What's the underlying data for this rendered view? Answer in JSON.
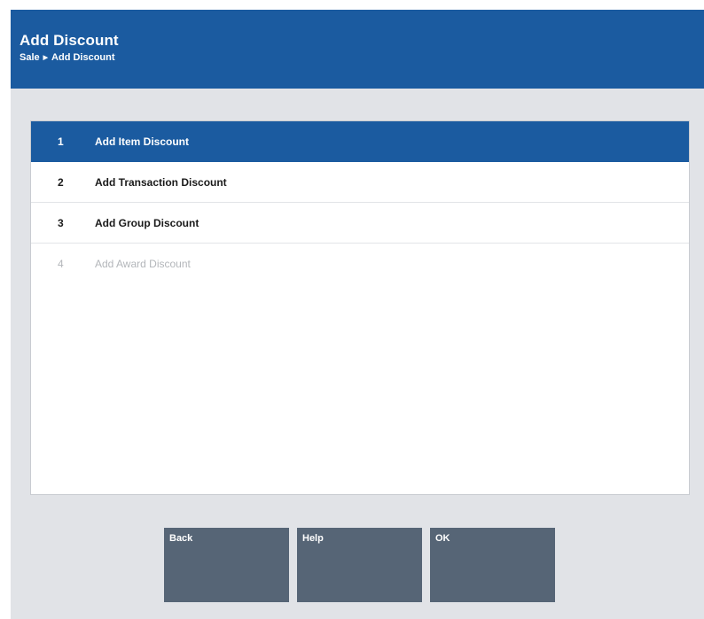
{
  "header": {
    "title": "Add Discount",
    "breadcrumb": [
      "Sale",
      "Add Discount"
    ]
  },
  "menu": {
    "items": [
      {
        "number": "1",
        "label": "Add Item Discount",
        "state": "selected"
      },
      {
        "number": "2",
        "label": "Add Transaction Discount",
        "state": "enabled"
      },
      {
        "number": "3",
        "label": "Add Group Discount",
        "state": "enabled"
      },
      {
        "number": "4",
        "label": "Add Award Discount",
        "state": "disabled"
      }
    ]
  },
  "buttons": {
    "back": "Back",
    "help": "Help",
    "ok": "OK"
  },
  "colors": {
    "header_bg": "#1b5ba0",
    "selected_bg": "#1b5ba0",
    "button_bg": "#566576",
    "disabled_text": "#b3b6ba",
    "panel_bg": "#e1e3e7"
  }
}
